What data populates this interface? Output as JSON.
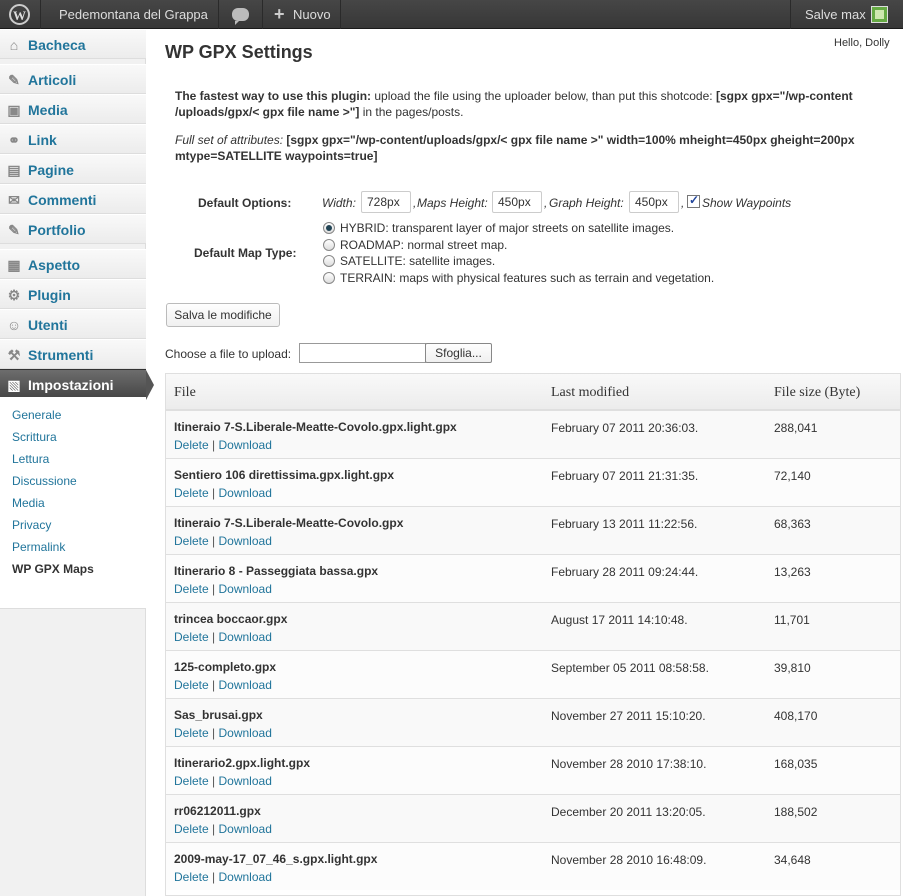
{
  "adminbar": {
    "wp_logo": "W",
    "site_name": "Pedemontana del Grappa",
    "comments_icon": "comment-bubble-icon",
    "new_label": "Nuovo",
    "greeting": "Salve max"
  },
  "sidebar": {
    "items": [
      {
        "label": "Bacheca",
        "icon": "⌂"
      },
      {
        "label": "Articoli",
        "icon": "✎"
      },
      {
        "label": "Media",
        "icon": "▣"
      },
      {
        "label": "Link",
        "icon": "⚭"
      },
      {
        "label": "Pagine",
        "icon": "▤"
      },
      {
        "label": "Commenti",
        "icon": "✉"
      },
      {
        "label": "Portfolio",
        "icon": "✎"
      },
      {
        "label": "Aspetto",
        "icon": "▦"
      },
      {
        "label": "Plugin",
        "icon": "⚙"
      },
      {
        "label": "Utenti",
        "icon": "☺"
      },
      {
        "label": "Strumenti",
        "icon": "⚒"
      },
      {
        "label": "Impostazioni",
        "icon": "▧"
      }
    ],
    "submenu": [
      "Generale",
      "Scrittura",
      "Lettura",
      "Discussione",
      "Media",
      "Privacy",
      "Permalink",
      "WP GPX Maps"
    ]
  },
  "page": {
    "title": "WP GPX Settings",
    "howdy": "Hello, Dolly",
    "intro_bold": "The fastest way to use this plugin:",
    "intro_text": " upload the file using the uploader below, than put this shotcode: ",
    "intro_code": "[sgpx gpx=\"/wp-content /uploads/gpx/< gpx file name >\"]",
    "intro_tail": " in the pages/posts.",
    "full_set_label": "Full set of attributes:",
    "full_set_code": " [sgpx gpx=\"/wp-content/uploads/gpx/< gpx file name >\" width=100% mheight=450px gheight=200px mtype=SATELLITE waypoints=true]"
  },
  "options": {
    "label": "Default Options:",
    "width_label": "Width:",
    "width_value": "728px",
    "maps_height_label": "Maps Height:",
    "maps_height_value": "450px",
    "graph_height_label": "Graph Height:",
    "graph_height_value": "450px",
    "sep": ",",
    "show_waypoints_label": "Show Waypoints",
    "show_waypoints_checked": true
  },
  "map_type": {
    "label": "Default Map Type:",
    "options": [
      {
        "label": "HYBRID: transparent layer of major streets on satellite images.",
        "selected": true
      },
      {
        "label": "ROADMAP: normal street map.",
        "selected": false
      },
      {
        "label": "SATELLITE: satellite images.",
        "selected": false
      },
      {
        "label": "TERRAIN: maps with physical features such as terrain and vegetation.",
        "selected": false
      }
    ]
  },
  "save_button": "Salva le modifiche",
  "upload": {
    "label": "Choose a file to upload:",
    "browse_button": "Sfoglia..."
  },
  "table": {
    "headers": [
      "File",
      "Last modified",
      "File size (Byte)"
    ],
    "delete_label": "Delete",
    "download_label": "Download",
    "separator": "|",
    "rows": [
      {
        "name": "Itineraio 7-S.Liberale-Meatte-Covolo.gpx.light.gpx",
        "date": "February 07 2011 20:36:03.",
        "size": "288,041"
      },
      {
        "name": "Sentiero 106 direttissima.gpx.light.gpx",
        "date": "February 07 2011 21:31:35.",
        "size": "72,140"
      },
      {
        "name": "Itineraio 7-S.Liberale-Meatte-Covolo.gpx",
        "date": "February 13 2011 11:22:56.",
        "size": "68,363"
      },
      {
        "name": "Itinerario 8 - Passeggiata bassa.gpx",
        "date": "February 28 2011 09:24:44.",
        "size": "13,263"
      },
      {
        "name": "trincea boccaor.gpx",
        "date": "August 17 2011 14:10:48.",
        "size": "11,701"
      },
      {
        "name": "125-completo.gpx",
        "date": "September 05 2011 08:58:58.",
        "size": "39,810"
      },
      {
        "name": "Sas_brusai.gpx",
        "date": "November 27 2011 15:10:20.",
        "size": "408,170"
      },
      {
        "name": "Itinerario2.gpx.light.gpx",
        "date": "November 28 2010 17:38:10.",
        "size": "168,035"
      },
      {
        "name": "rr06212011.gpx",
        "date": "December 20 2011 13:20:05.",
        "size": "188,502"
      },
      {
        "name": "2009-may-17_07_46_s.gpx.light.gpx",
        "date": "November 28 2010 16:48:09.",
        "size": "34,648"
      }
    ]
  }
}
